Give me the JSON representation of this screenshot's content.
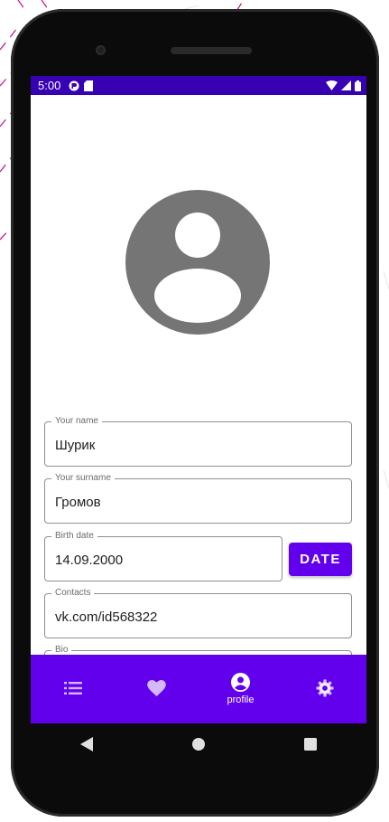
{
  "status_bar": {
    "time": "5:00"
  },
  "profile": {
    "fields": [
      {
        "label": "Your name",
        "value": "Шурик"
      },
      {
        "label": "Your surname",
        "value": "Громов"
      },
      {
        "label": "Birth date",
        "value": "14.09.2000"
      },
      {
        "label": "Contacts",
        "value": "vk.com/id568322"
      },
      {
        "label": "Bio",
        "value": ""
      }
    ],
    "date_button_label": "DATE"
  },
  "bottom_nav": {
    "items": [
      {
        "icon": "list-icon",
        "label": ""
      },
      {
        "icon": "heart-icon",
        "label": ""
      },
      {
        "icon": "account-circle-icon",
        "label": "profile"
      },
      {
        "icon": "gear-icon",
        "label": ""
      }
    ],
    "active_index": 2
  },
  "colors": {
    "status_bar": "#3700b3",
    "primary": "#6200ee",
    "avatar": "#757575"
  }
}
